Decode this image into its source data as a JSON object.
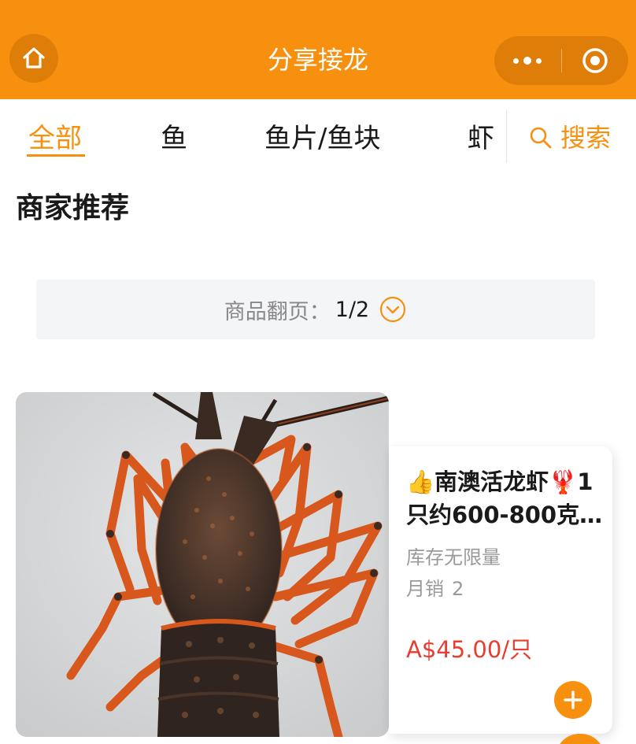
{
  "header": {
    "title": "分享接龙",
    "home_icon": "home-icon",
    "more_icon": "more-dots-icon",
    "close_icon": "target-close-icon",
    "bg_color": "#f7900f"
  },
  "tabs": [
    {
      "label": "全部",
      "active": true
    },
    {
      "label": "鱼",
      "active": false
    },
    {
      "label": "鱼片/鱼块",
      "active": false
    },
    {
      "label": "虾",
      "active": false
    }
  ],
  "search": {
    "label": "搜索",
    "icon": "search-icon"
  },
  "section": {
    "title": "商家推荐"
  },
  "pager": {
    "label": "商品翻页：",
    "value": "1/2",
    "icon": "chevron-down-circle-icon"
  },
  "product": {
    "name": "👍南澳活龙虾🦞1只约600-800克…",
    "stock": "库存无限量",
    "sales_label": "月销",
    "sales_value": "2",
    "price": "A$45.00/只",
    "image": "lobster-photo",
    "add_icon": "plus-icon",
    "price_color": "#e83d2f"
  }
}
